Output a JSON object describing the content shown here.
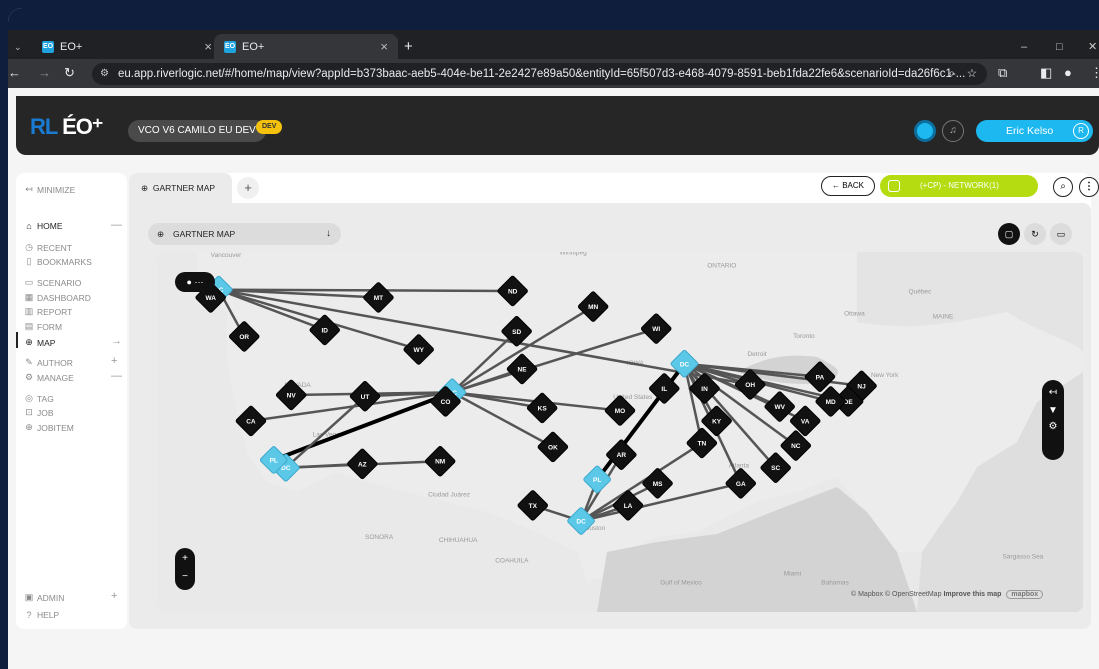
{
  "browser": {
    "tabs": [
      {
        "title": "EO+",
        "close": "×"
      },
      {
        "title": "EO+",
        "close": "×"
      }
    ],
    "new_tab": "+",
    "url": "eu.app.riverlogic.net/#/home/map/view?appId=b373baac-aeb5-404e-be11-2e2427e89a50&entityId=65f507d3-e468-4079-8591-beb1fda22fe6&scenarioId=da26f6c1-...",
    "window_controls": [
      "–",
      "□",
      "✕"
    ]
  },
  "header": {
    "logo_rl": "RL",
    "logo_eo": "ÉO⁺",
    "environment": "VCO V6 CAMILO EU DEV",
    "badge": "DEV",
    "user": "Eric Kelso",
    "user_initial": "R"
  },
  "sidebar": {
    "minimize": "MINIMIZE",
    "items": [
      {
        "label": "HOME",
        "icon": "home-icon",
        "glyph": "⌂",
        "action": "—"
      },
      {
        "label": "RECENT",
        "icon": "clock-icon",
        "glyph": "◷"
      },
      {
        "label": "BOOKMARKS",
        "icon": "bookmark-icon",
        "glyph": "▯"
      },
      {
        "label": "SCENARIO",
        "icon": "scenario-icon",
        "glyph": "▭"
      },
      {
        "label": "DASHBOARD",
        "icon": "dashboard-icon",
        "glyph": "▦"
      },
      {
        "label": "REPORT",
        "icon": "report-icon",
        "glyph": "▥"
      },
      {
        "label": "FORM",
        "icon": "form-icon",
        "glyph": "▤"
      },
      {
        "label": "MAP",
        "icon": "globe-icon",
        "glyph": "⊕",
        "action": "→"
      },
      {
        "label": "AUTHOR",
        "icon": "wrench-icon",
        "glyph": "✎",
        "action": "+"
      },
      {
        "label": "MANAGE",
        "icon": "manage-icon",
        "glyph": "⚙",
        "action": "—"
      },
      {
        "label": "TAG",
        "icon": "tag-icon",
        "glyph": "◎"
      },
      {
        "label": "JOB",
        "icon": "job-icon",
        "glyph": "⊡"
      },
      {
        "label": "JOBITEM",
        "icon": "jobitem-icon",
        "glyph": "⊕"
      }
    ],
    "admin": "ADMIN",
    "admin_action": "+",
    "help": "HELP"
  },
  "page": {
    "tab": "GARTNER MAP",
    "add_tab": "+",
    "back": "BACK",
    "network": "(+CP) - NETWORK(1)",
    "map_select": "GARTNER MAP",
    "map_menu": "⋯",
    "attribution": "© Mapbox © OpenStreetMap",
    "improve": "Improve this map",
    "mapbox": "mapbox"
  },
  "colors": {
    "accent": "#1db8f0",
    "network": "#b4dc11",
    "dc_node": "#5bc8e8",
    "customer_node": "#111111"
  },
  "map": {
    "region_labels": [
      "Vancouver",
      "Winnipeg",
      "ONTARIO",
      "Québec",
      "Ottawa",
      "Toronto",
      "Detroit",
      "New York",
      "NEVADA",
      "Las Vegas",
      "United States",
      "IOWA",
      "SONORA",
      "CHIHUAHUA",
      "COAHUILA",
      "Ciudad Juárez",
      "Houston",
      "Atlanta",
      "Gulf of Mexico",
      "Miami",
      "Bahamas",
      "Sargasso Sea",
      "MAINE"
    ],
    "nodes": [
      {
        "label": "DC",
        "kind": "dc",
        "lon": -122.4,
        "lat": 47.6
      },
      {
        "label": "DC",
        "kind": "dc",
        "lon": -105.0,
        "lat": 39.7
      },
      {
        "label": "DC",
        "kind": "dc",
        "lon": -87.7,
        "lat": 41.9
      },
      {
        "label": "DC",
        "kind": "dc",
        "lon": -117.4,
        "lat": 33.9
      },
      {
        "label": "DC",
        "kind": "dc",
        "lon": -95.4,
        "lat": 29.8
      },
      {
        "label": "PL",
        "kind": "plant",
        "lon": -118.3,
        "lat": 34.5
      },
      {
        "label": "PL",
        "kind": "plant",
        "lon": -94.2,
        "lat": 33.0
      },
      {
        "label": "WA",
        "kind": "customer",
        "lon": -123.0,
        "lat": 47.0
      },
      {
        "label": "OR",
        "kind": "customer",
        "lon": -120.5,
        "lat": 44.0
      },
      {
        "label": "ID",
        "kind": "customer",
        "lon": -114.5,
        "lat": 44.5
      },
      {
        "label": "MT",
        "kind": "customer",
        "lon": -110.5,
        "lat": 47.0
      },
      {
        "label": "WY",
        "kind": "customer",
        "lon": -107.5,
        "lat": 43.0
      },
      {
        "label": "ND",
        "kind": "customer",
        "lon": -100.5,
        "lat": 47.5
      },
      {
        "label": "SD",
        "kind": "customer",
        "lon": -100.2,
        "lat": 44.4
      },
      {
        "label": "NE",
        "kind": "customer",
        "lon": -99.8,
        "lat": 41.5
      },
      {
        "label": "MN",
        "kind": "customer",
        "lon": -94.5,
        "lat": 46.3
      },
      {
        "label": "WI",
        "kind": "customer",
        "lon": -89.8,
        "lat": 44.6
      },
      {
        "label": "CA",
        "kind": "customer",
        "lon": -120.0,
        "lat": 37.5
      },
      {
        "label": "NV",
        "kind": "customer",
        "lon": -117.0,
        "lat": 39.5
      },
      {
        "label": "UT",
        "kind": "customer",
        "lon": -111.5,
        "lat": 39.4
      },
      {
        "label": "CO",
        "kind": "customer",
        "lon": -105.5,
        "lat": 39.0
      },
      {
        "label": "AZ",
        "kind": "customer",
        "lon": -111.7,
        "lat": 34.2
      },
      {
        "label": "NM",
        "kind": "customer",
        "lon": -105.9,
        "lat": 34.4
      },
      {
        "label": "KS",
        "kind": "customer",
        "lon": -98.3,
        "lat": 38.5
      },
      {
        "label": "MO",
        "kind": "customer",
        "lon": -92.5,
        "lat": 38.3
      },
      {
        "label": "OK",
        "kind": "customer",
        "lon": -97.5,
        "lat": 35.5
      },
      {
        "label": "AR",
        "kind": "customer",
        "lon": -92.4,
        "lat": 34.9
      },
      {
        "label": "TX",
        "kind": "customer",
        "lon": -99.0,
        "lat": 31.0
      },
      {
        "label": "LA",
        "kind": "customer",
        "lon": -91.9,
        "lat": 31.0
      },
      {
        "label": "MS",
        "kind": "customer",
        "lon": -89.7,
        "lat": 32.7
      },
      {
        "label": "IL",
        "kind": "customer",
        "lon": -89.2,
        "lat": 40.0
      },
      {
        "label": "IN",
        "kind": "customer",
        "lon": -86.2,
        "lat": 40.0
      },
      {
        "label": "KY",
        "kind": "customer",
        "lon": -85.3,
        "lat": 37.5
      },
      {
        "label": "TN",
        "kind": "customer",
        "lon": -86.4,
        "lat": 35.8
      },
      {
        "label": "OH",
        "kind": "customer",
        "lon": -82.8,
        "lat": 40.3
      },
      {
        "label": "WV",
        "kind": "customer",
        "lon": -80.6,
        "lat": 38.6
      },
      {
        "label": "VA",
        "kind": "customer",
        "lon": -78.7,
        "lat": 37.5
      },
      {
        "label": "PA",
        "kind": "customer",
        "lon": -77.6,
        "lat": 40.9
      },
      {
        "label": "NJ",
        "kind": "customer",
        "lon": -74.5,
        "lat": 40.2
      },
      {
        "label": "DE",
        "kind": "customer",
        "lon": -75.5,
        "lat": 39.0
      },
      {
        "label": "MD",
        "kind": "customer",
        "lon": -76.8,
        "lat": 39.0
      },
      {
        "label": "NC",
        "kind": "customer",
        "lon": -79.4,
        "lat": 35.6
      },
      {
        "label": "SC",
        "kind": "customer",
        "lon": -80.9,
        "lat": 33.9
      },
      {
        "label": "GA",
        "kind": "customer",
        "lon": -83.5,
        "lat": 32.7
      }
    ]
  }
}
